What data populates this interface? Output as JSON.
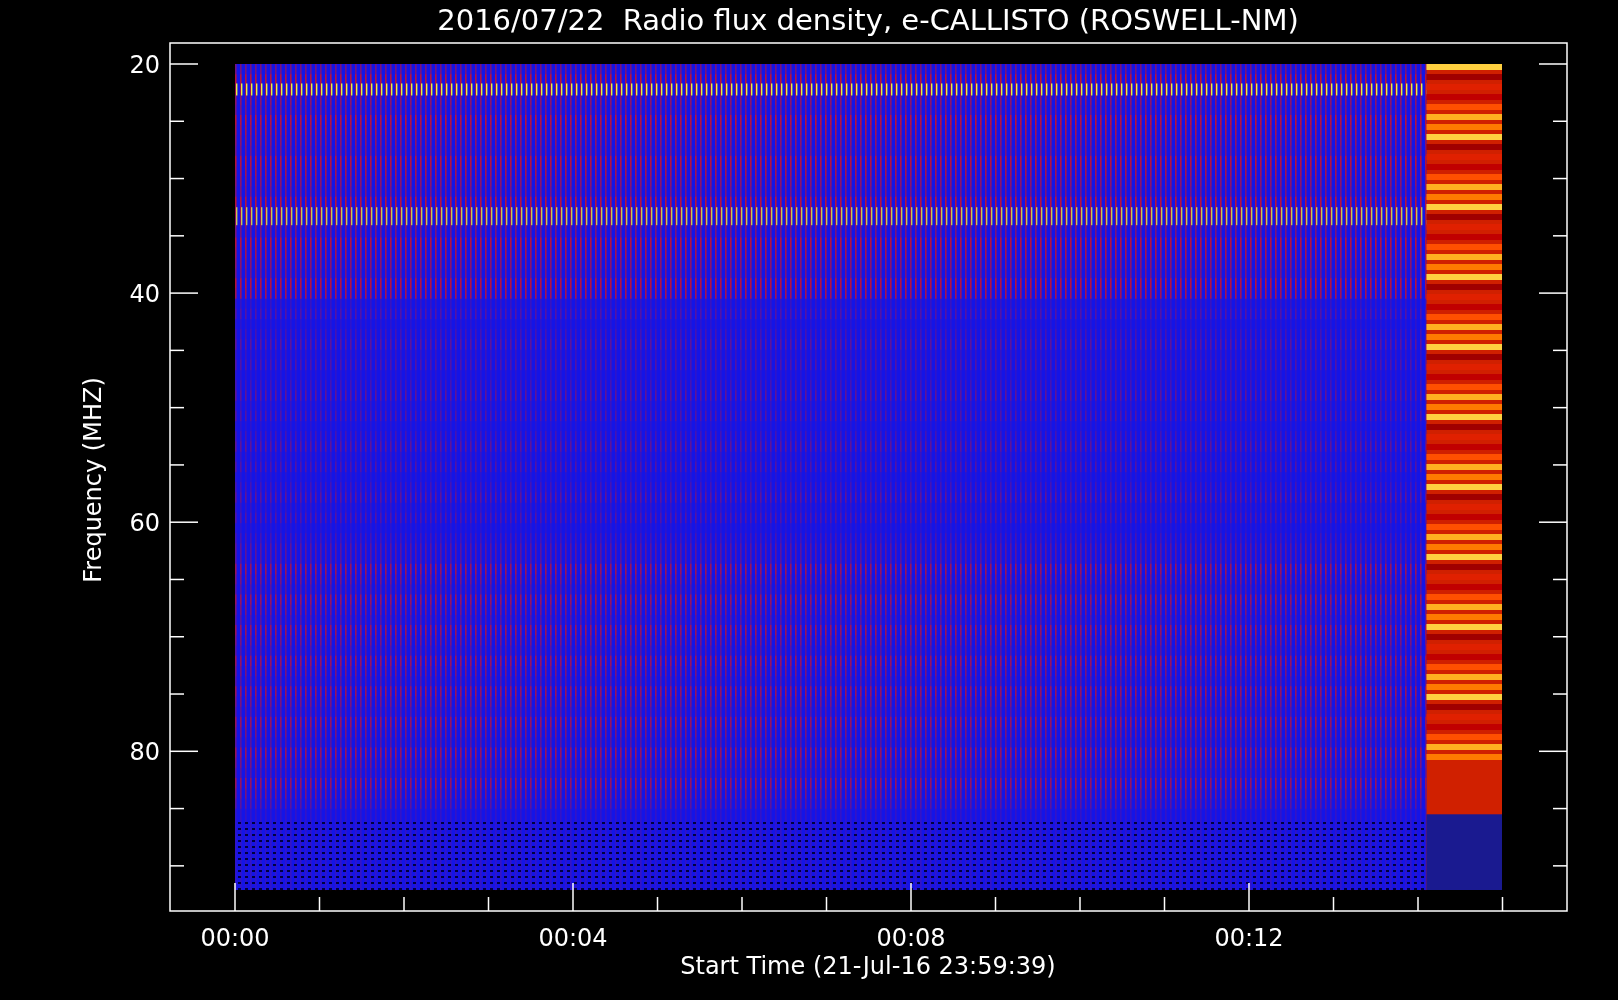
{
  "plot": {
    "title": "2016/07/22  Radio flux density, e-CALLISTO (ROSWELL-NM)",
    "ylabel": "Frequency (MHZ)",
    "xlabel": "Start Time (21-Jul-16 23:59:39)",
    "yticks": [
      "20",
      "40",
      "60",
      "80"
    ],
    "xticks": [
      "00:00",
      "00:04",
      "00:08",
      "00:12"
    ]
  }
}
